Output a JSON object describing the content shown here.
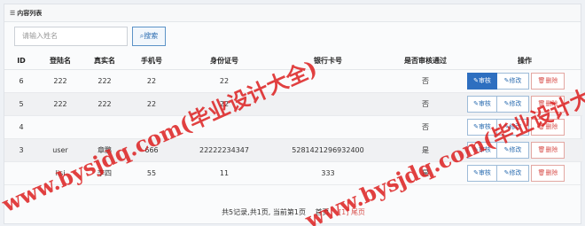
{
  "panel": {
    "title": "内容列表"
  },
  "search": {
    "placeholder": "请输入姓名",
    "button_label": "搜索"
  },
  "table": {
    "headers": [
      "ID",
      "登陆名",
      "真实名",
      "手机号",
      "身份证号",
      "银行卡号",
      "是否审核通过",
      "操作"
    ],
    "rows": [
      {
        "id": "6",
        "login": "222",
        "real": "222",
        "phone": "22",
        "idcard": "22",
        "bank": "",
        "audit": "否"
      },
      {
        "id": "5",
        "login": "222",
        "real": "222",
        "phone": "22",
        "idcard": "22",
        "bank": "",
        "audit": "否"
      },
      {
        "id": "4",
        "login": "",
        "real": "",
        "phone": "",
        "idcard": "",
        "bank": "",
        "audit": "否"
      },
      {
        "id": "3",
        "login": "user",
        "real": "章鹏",
        "phone": "666",
        "idcard": "22222234347",
        "bank": "5281421296932400",
        "audit": "是"
      },
      {
        "id": "",
        "login": "lisi",
        "real": "李四",
        "phone": "55",
        "idcard": "11",
        "bank": "333",
        "audit": "是"
      }
    ],
    "ops": {
      "audit": "审核",
      "edit": "修改",
      "delete": "删除"
    }
  },
  "pager": {
    "summary": "共5记录,共1页, 当前第1页",
    "first": "首页",
    "current": "[1] 尾页"
  },
  "watermark": {
    "text": "www.bysjdq.com(毕业设计大全)"
  },
  "colors": {
    "primary": "#2e6fc0",
    "danger": "#d9534f",
    "watermark": "#dc1e1e"
  }
}
